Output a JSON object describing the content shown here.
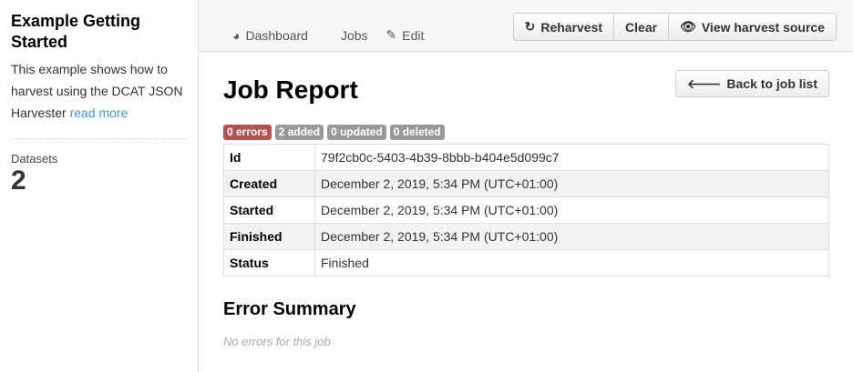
{
  "sidebar": {
    "title": "Example Getting Started",
    "description": "This example shows how to harvest using the DCAT JSON Harvester",
    "read_more": "read more",
    "datasets_label": "Datasets",
    "datasets_count": "2"
  },
  "tabs": [
    {
      "label": "Dashboard",
      "icon": "dashboard-icon"
    },
    {
      "label": "Jobs"
    },
    {
      "label": "Edit",
      "icon": "edit-icon"
    }
  ],
  "actions": {
    "reharvest": "Reharvest",
    "clear": "Clear",
    "view_source": "View harvest source"
  },
  "main": {
    "title": "Job Report",
    "back": "Back to job list",
    "badges": [
      "0 errors",
      "2 added",
      "0 updated",
      "0 deleted"
    ],
    "rows": [
      {
        "k": "Id",
        "v": "79f2cb0c-5403-4b39-8bbb-b404e5d099c7"
      },
      {
        "k": "Created",
        "v": "December 2, 2019, 5:34 PM (UTC+01:00)"
      },
      {
        "k": "Started",
        "v": "December 2, 2019, 5:34 PM (UTC+01:00)"
      },
      {
        "k": "Finished",
        "v": "December 2, 2019, 5:34 PM (UTC+01:00)"
      },
      {
        "k": "Status",
        "v": "Finished"
      }
    ],
    "error_title": "Error Summary",
    "no_errors": "No errors for this job"
  },
  "colors": {
    "link": "#3a9ad9",
    "error_badge": "#b55353",
    "badge": "#999999"
  }
}
